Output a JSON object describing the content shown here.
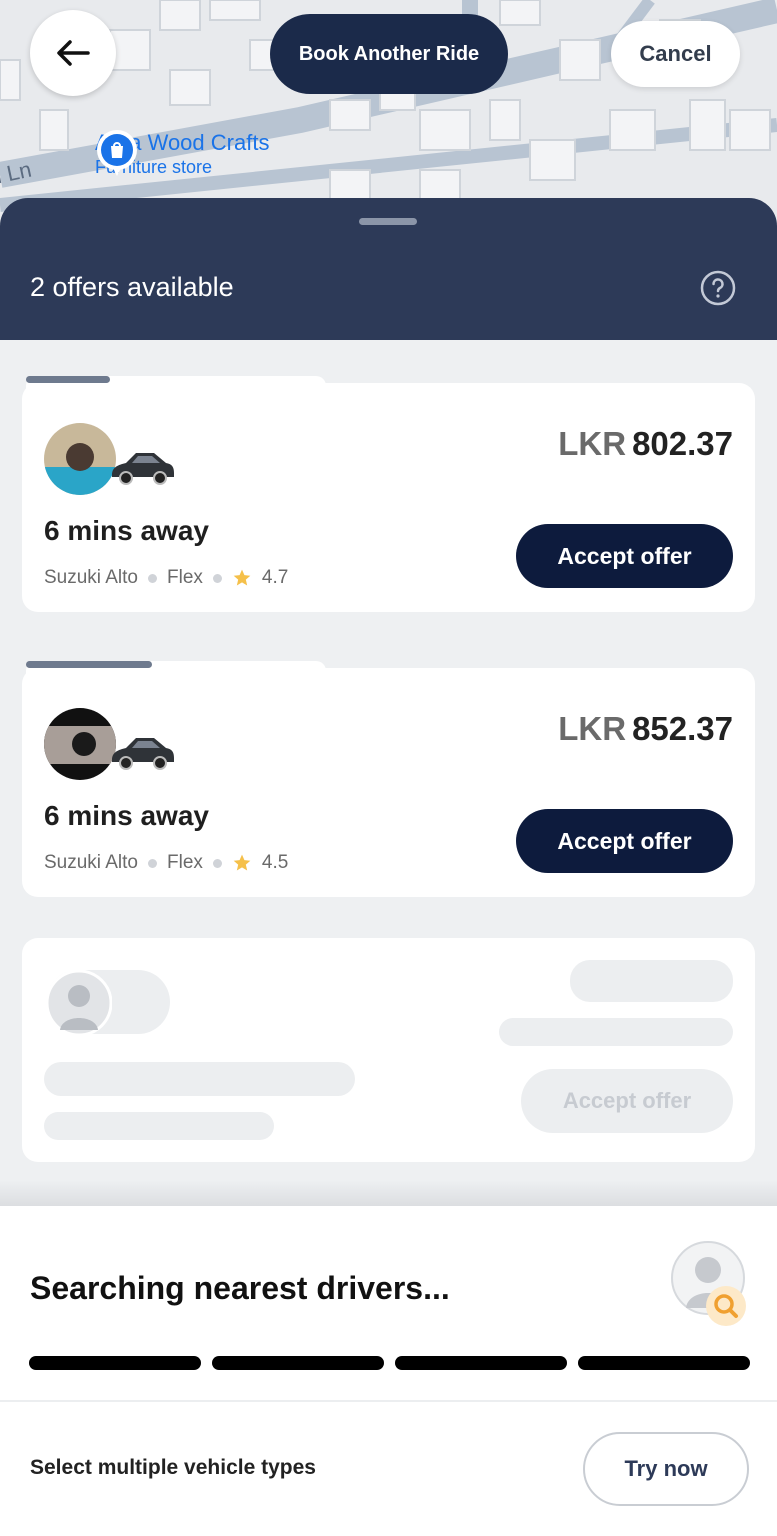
{
  "map": {
    "poi_name": "Aura Wood Crafts",
    "poi_category": "Furniture store",
    "street_label": "l Ln"
  },
  "top_bar": {
    "back_icon": "arrow-left-icon",
    "book_another_label": "Book Another Ride",
    "cancel_label": "Cancel"
  },
  "sheet": {
    "title": "2 offers available",
    "help_icon": "question-circle-icon"
  },
  "offers": [
    {
      "currency": "LKR",
      "amount": "802.37",
      "eta": "6 mins away",
      "vehicle": "Suzuki Alto",
      "type": "Flex",
      "rating": "4.7",
      "accept_label": "Accept offer",
      "timer_progress": 0.28
    },
    {
      "currency": "LKR",
      "amount": "852.37",
      "eta": "6 mins away",
      "vehicle": "Suzuki Alto",
      "type": "Flex",
      "rating": "4.5",
      "accept_label": "Accept offer",
      "timer_progress": 0.42
    }
  ],
  "placeholder_card": {
    "accept_label": "Accept offer"
  },
  "searching": {
    "title": "Searching nearest drivers...",
    "icon": "driver-search-icon"
  },
  "footer": {
    "label": "Select multiple vehicle types",
    "button_label": "Try now"
  },
  "colors": {
    "navy": "#1b2a4a",
    "sheet_header": "#2d3a58",
    "accept": "#0d1b3d",
    "star": "#f5c04a",
    "search_accent": "#f0a030"
  }
}
